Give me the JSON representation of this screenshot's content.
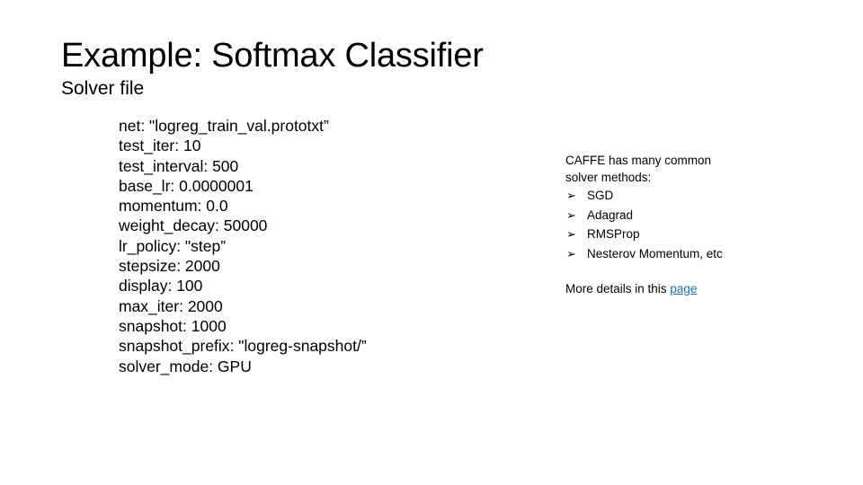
{
  "slide": {
    "title": "Example: Softmax Classifier",
    "subtitle": "Solver file"
  },
  "solver_file": {
    "lines": [
      "net: \"logreg_train_val.prototxt”",
      "test_iter: 10",
      "test_interval: 500",
      "base_lr: 0.0000001",
      "momentum: 0.0",
      "weight_decay: 50000",
      "lr_policy: \"step”",
      "stepsize: 2000",
      "display: 100",
      "max_iter: 2000",
      "snapshot: 1000",
      "snapshot_prefix: \"logreg-snapshot/”",
      "solver_mode: GPU"
    ]
  },
  "notes": {
    "lead_line_1": "CAFFE has many common",
    "lead_line_2": "solver methods:",
    "bullet_marker": "➢",
    "bullets": [
      "SGD",
      "Adagrad",
      "RMSProp",
      "Nesterov Momentum, etc"
    ],
    "footer_text": "More details in this ",
    "footer_link": "page",
    "link_color": "#1f6fa8"
  }
}
